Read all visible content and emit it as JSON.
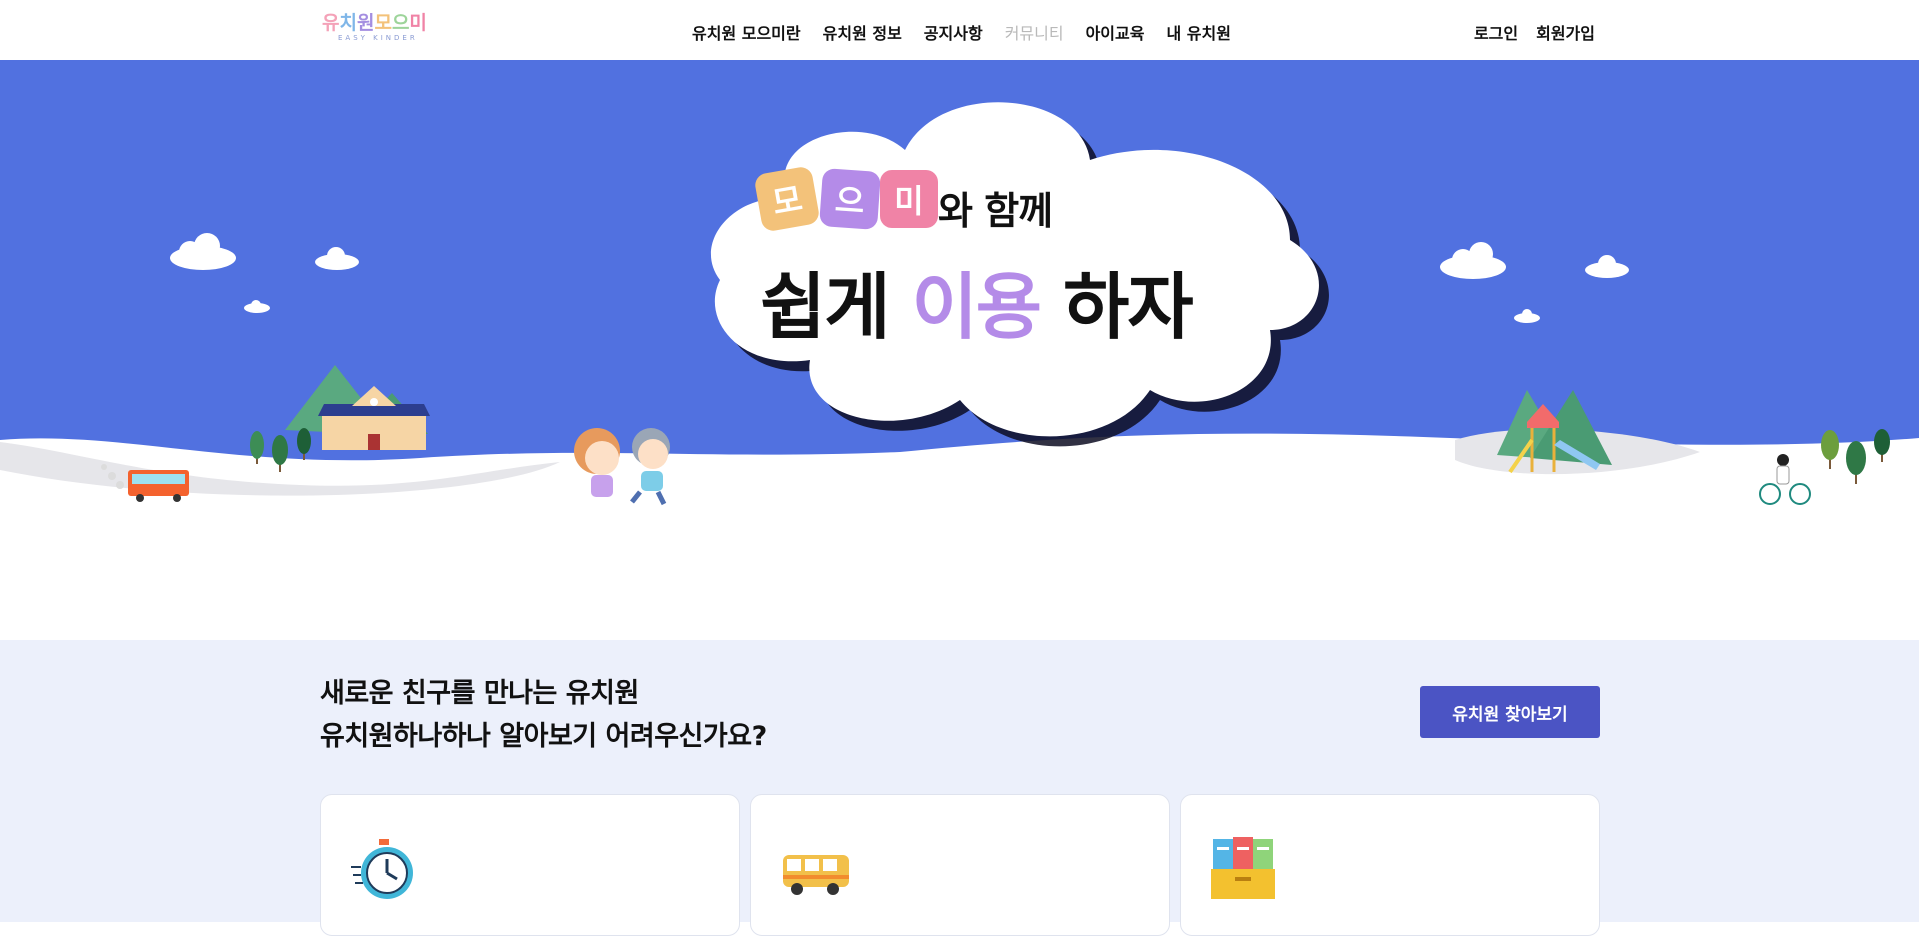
{
  "header": {
    "logo": {
      "title_chars": [
        "유",
        "치",
        "원",
        "모",
        "으",
        "미"
      ],
      "subtitle": "EASY KINDER"
    },
    "nav": [
      {
        "label": "유치원 모으미란",
        "enabled": true
      },
      {
        "label": "유치원 정보",
        "enabled": true
      },
      {
        "label": "공지사항",
        "enabled": true
      },
      {
        "label": "커뮤니티",
        "enabled": false
      },
      {
        "label": "아이교육",
        "enabled": true
      },
      {
        "label": "내 유치원",
        "enabled": true
      }
    ],
    "auth": {
      "login": "로그인",
      "signup": "회원가입"
    }
  },
  "hero": {
    "tiles": [
      "모",
      "으",
      "미"
    ],
    "tile_colors": [
      "#f3c27a",
      "#b48be8",
      "#f083a6"
    ],
    "with_text": "와 함께",
    "headline_before": "쉽게",
    "headline_accent": "이용",
    "headline_after": "하자",
    "sky_color": "#5171e0"
  },
  "section": {
    "title_line1": "새로운 친구를 만나는 유치원",
    "title_line2": "유치원하나하나 알아보기 어려우신가요?",
    "find_button": "유치원 찾아보기",
    "cards": [
      {
        "icon": "stopwatch-icon"
      },
      {
        "icon": "school-bus-icon"
      },
      {
        "icon": "document-folders-icon"
      }
    ]
  }
}
